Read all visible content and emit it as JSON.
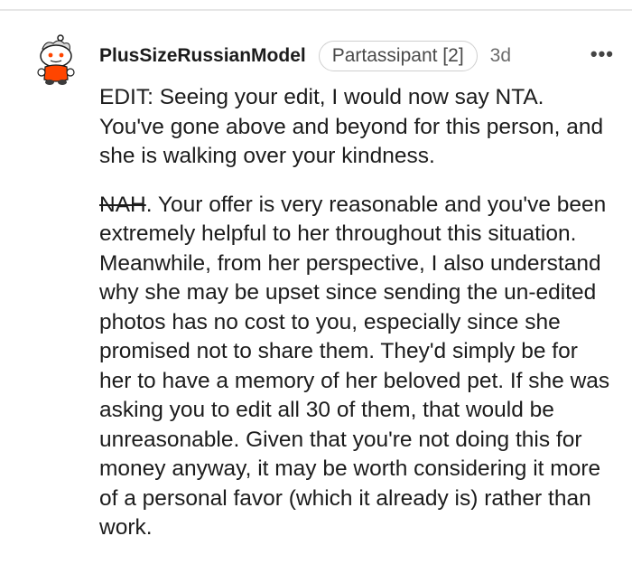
{
  "comment": {
    "username": "PlusSizeRussianModel",
    "flair": "Partassipant [2]",
    "time": "3d",
    "more_label": "•••",
    "edit_text": "EDIT: Seeing your edit, I would now say NTA. You've gone above and beyond for this person, and she is walking over your kindness.",
    "struck_text": "NAH",
    "main_text": ". Your offer is very reasonable and you've been extremely helpful to her throughout this situation. Meanwhile, from her perspective, I also understand why she may be upset since sending the un-edited photos has no cost to you, especially since she promised not to share them. They'd simply be for her to have a memory of her beloved pet. If she was asking you to edit all 30 of them, that would be unreasonable. Given that you're not doing this for money anyway, it may be worth considering it more of a personal favor (which it already is) rather than work."
  },
  "colors": {
    "text": "#1c1c1c",
    "meta": "#6b6b6b",
    "avatar_accent": "#ff4500"
  },
  "icons": {
    "avatar": "snoo-avatar-icon",
    "more": "more-options-icon"
  }
}
